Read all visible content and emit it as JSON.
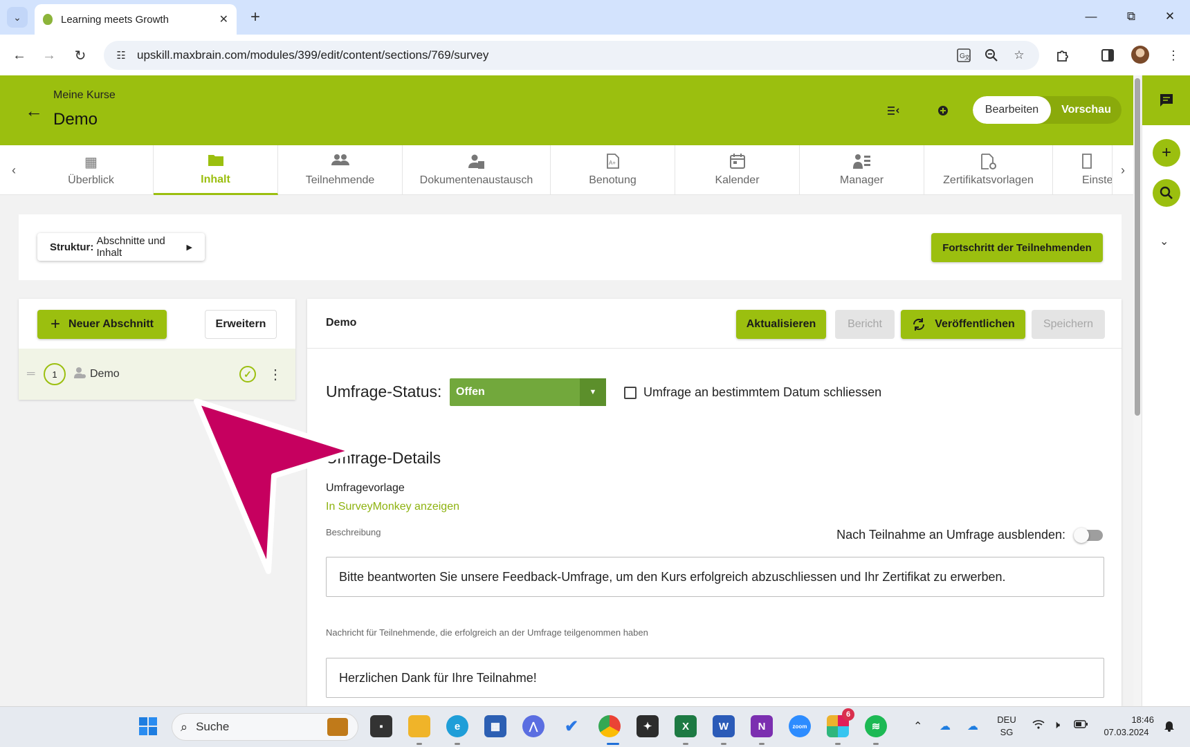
{
  "browser": {
    "tab_title": "Learning meets Growth",
    "tab_close": "✕",
    "new_tab": "+",
    "url": "upskill.maxbrain.com/modules/399/edit/content/sections/769/survey",
    "window_controls": {
      "minimize": "—",
      "restore": "⧉",
      "close": "✕"
    },
    "nav": {
      "back": "←",
      "forward": "→",
      "reload": "↻"
    },
    "toolbar_icons": [
      "translate-icon",
      "zoom-icon",
      "star-icon",
      "extensions-icon",
      "side-panel-icon",
      "profile-avatar",
      "menu-icon"
    ]
  },
  "header": {
    "breadcrumb": "Meine Kurse",
    "title": "Demo",
    "mode_edit": "Bearbeiten",
    "mode_preview": "Vorschau",
    "brand_color": "#9bbf0f"
  },
  "module_tabs": [
    {
      "label": "Überblick",
      "icon": "dashboard-icon"
    },
    {
      "label": "Inhalt",
      "icon": "folder-icon",
      "active": true
    },
    {
      "label": "Teilnehmende",
      "icon": "people-icon"
    },
    {
      "label": "Dokumentenaustausch",
      "icon": "person-doc-icon"
    },
    {
      "label": "Benotung",
      "icon": "grade-doc-icon"
    },
    {
      "label": "Kalender",
      "icon": "calendar-icon"
    },
    {
      "label": "Manager",
      "icon": "manager-icon"
    },
    {
      "label": "Zertifikatsvorlagen",
      "icon": "certificate-icon"
    },
    {
      "label": "Einste",
      "icon": "settings-doc-icon"
    }
  ],
  "structure": {
    "label_bold": "Struktur:",
    "label_value": "Abschnitte und Inhalt",
    "progress_button": "Fortschritt der Teilnehmenden"
  },
  "sections": {
    "new_section_button": "Neuer Abschnitt",
    "expand_button": "Erweitern",
    "items": [
      {
        "number": "1",
        "name": "Demo",
        "status": "complete"
      }
    ]
  },
  "content": {
    "title": "Demo",
    "buttons": {
      "update": "Aktualisieren",
      "report": "Bericht",
      "publish": "Veröffentlichen",
      "save": "Speichern"
    },
    "status_label": "Umfrage-Status:",
    "status_value": "Offen",
    "close_on_date_label": "Umfrage an bestimmtem Datum schliessen",
    "details_title": "Umfrage-Details",
    "template_label": "Umfragevorlage",
    "template_link": "In SurveyMonkey anzeigen",
    "description_label": "Beschreibung",
    "hide_after_label": "Nach Teilnahme an Umfrage ausblenden:",
    "hide_after_enabled": false,
    "description_text": "Bitte beantworten Sie unsere Feedback-Umfrage, um den Kurs erfolgreich abzuschliessen und Ihr Zertifikat zu erwerben.",
    "message_label": "Nachricht für Teilnehmende, die erfolgreich an der Umfrage teilgenommen haben",
    "message_text": "Herzlichen Dank für Ihre Teilnahme!"
  },
  "taskbar": {
    "search_placeholder": "Suche",
    "language": "DEU",
    "region": "SG",
    "time": "18:46",
    "date": "07.03.2024",
    "slack_badge": "6"
  }
}
